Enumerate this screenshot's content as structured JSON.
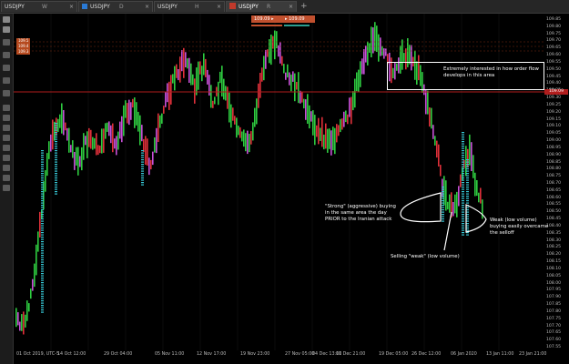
{
  "tabs": [
    {
      "label": "USDJPY",
      "sub": "W",
      "close": "×",
      "badge": ""
    },
    {
      "label": "USDJPY",
      "sub": "D",
      "close": "×",
      "badge": "blue"
    },
    {
      "label": "USDJPY",
      "sub": "H",
      "close": "×",
      "badge": ""
    },
    {
      "label": "USDJPY",
      "sub": "R",
      "close": "×",
      "badge": "red",
      "active": true
    }
  ],
  "add_tab": "+",
  "trade": {
    "sell_price": "109.09",
    "buy_price": "109.09"
  },
  "level_tags": [
    "109.5",
    "109.4",
    "109.3"
  ],
  "y_axis": {
    "labels": [
      "109.85",
      "109.80",
      "109.75",
      "109.70",
      "109.65",
      "109.60",
      "109.55",
      "109.50",
      "109.45",
      "109.40",
      "109.35",
      "109.30",
      "109.25",
      "109.20",
      "109.15",
      "109.10",
      "109.05",
      "109.00",
      "108.95",
      "108.90",
      "108.85",
      "108.80",
      "108.75",
      "108.70",
      "108.65",
      "108.60",
      "108.55",
      "108.50",
      "108.45",
      "108.40",
      "108.35",
      "108.30",
      "108.25",
      "108.20",
      "108.15",
      "108.10",
      "108.05",
      "108.00",
      "107.95",
      "107.90",
      "107.85",
      "107.80",
      "107.75",
      "107.70",
      "107.65",
      "107.60",
      "107.55"
    ],
    "current": "109.09"
  },
  "x_axis": {
    "labels": [
      "01 Oct 2019, UTC-5",
      "14 Oct 12:00",
      "29 Oct 04:00",
      "05 Nov 11:00",
      "12 Nov 17:00",
      "19 Nov 23:00",
      "27 Nov 05:00",
      "04 Dec 13:00",
      "11 Dec 21:00",
      "19 Dec 05:00",
      "26 Dec 12:00",
      "06 Jan 2020",
      "13 Jan 11:00",
      "23 Jan 21:00"
    ]
  },
  "annotations": {
    "box_text_1": "Extremely interested in how order flow",
    "box_text_2": "develops in this area",
    "strong_1": "\"Strong\" (aggressive) buying",
    "strong_2": "in the same area the day",
    "strong_3": "PRIOR to the Iranian attack",
    "weak_1": "Weak (low volume)",
    "weak_2": "buying easily overcame",
    "weak_3": "the selloff",
    "selling": "Selling \"weak\" (low volume)"
  },
  "colors": {
    "up": "#2ecc40",
    "down": "#e0303a",
    "chop": "#c850d8",
    "cyan": "#36c9d6",
    "hline": "#b11d1d",
    "bg": "#000000"
  }
}
